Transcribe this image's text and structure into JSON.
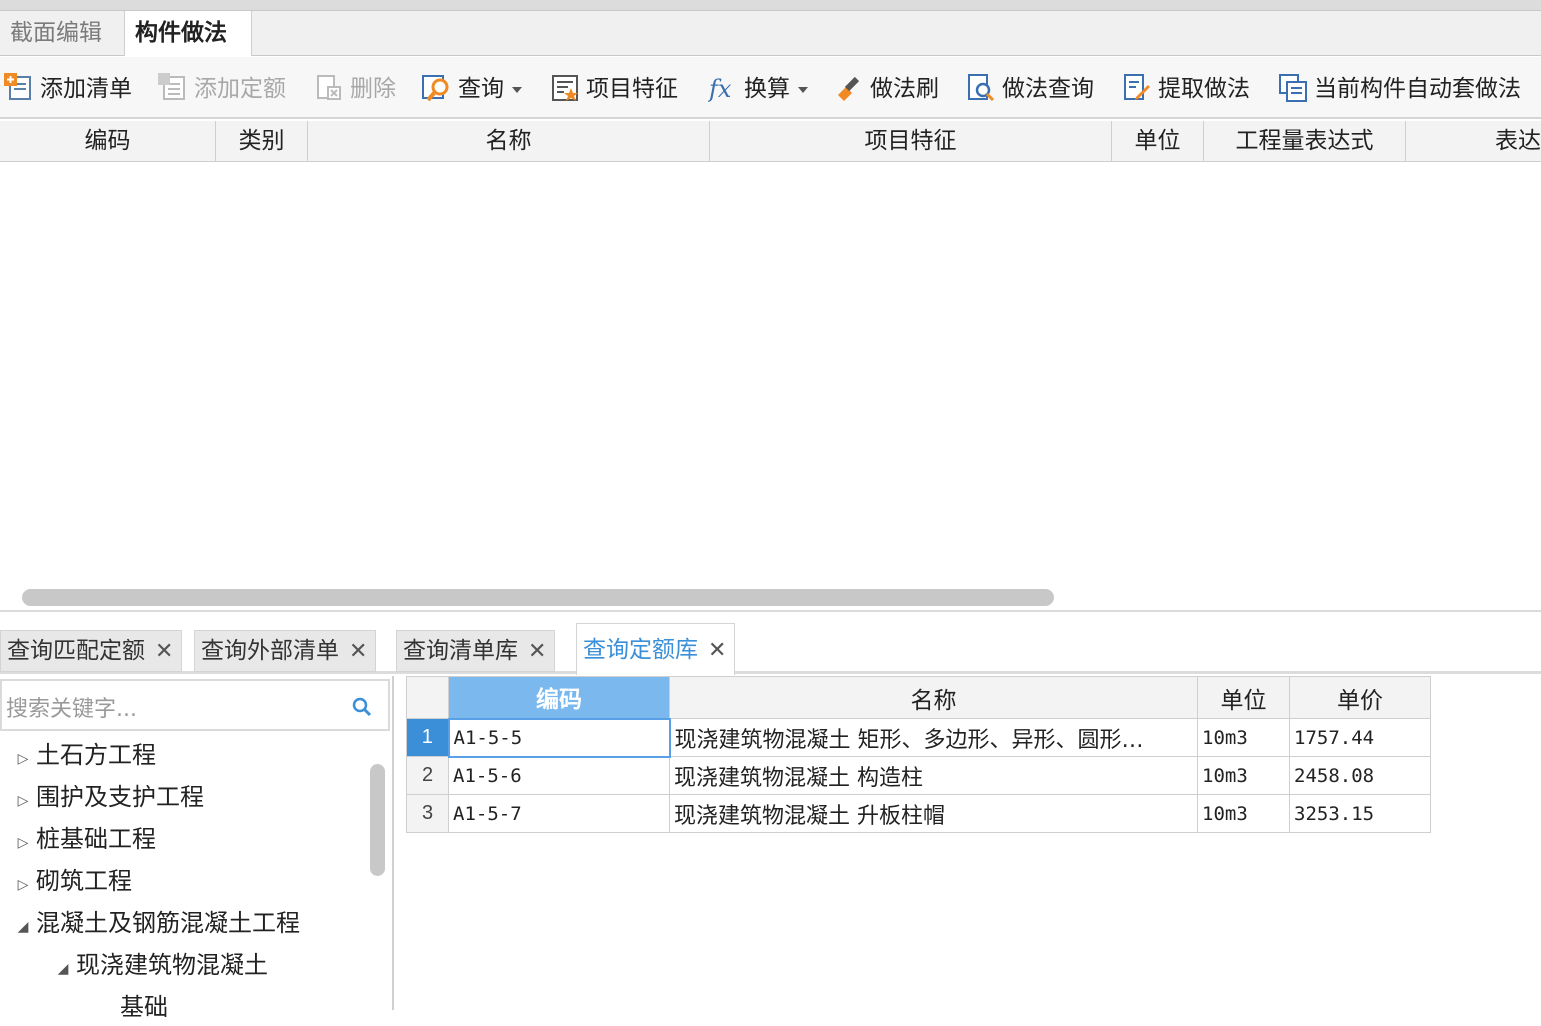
{
  "tabs": [
    {
      "label": "截面编辑",
      "active": false
    },
    {
      "label": "构件做法",
      "active": true
    }
  ],
  "toolbar": {
    "add_list": "添加清单",
    "add_quota": "添加定额",
    "delete": "删除",
    "query": "查询",
    "item_feature": "项目特征",
    "convert": "换算",
    "method_brush": "做法刷",
    "method_query": "做法查询",
    "extract_method": "提取做法",
    "auto_apply": "当前构件自动套做法"
  },
  "main_grid": {
    "columns": [
      "编码",
      "类别",
      "名称",
      "项目特征",
      "单位",
      "工程量表达式",
      "表达"
    ]
  },
  "query_tabs": [
    {
      "label": "查询匹配定额",
      "active": false
    },
    {
      "label": "查询外部清单",
      "active": false
    },
    {
      "label": "查询清单库",
      "active": false
    },
    {
      "label": "查询定额库",
      "active": true
    }
  ],
  "search": {
    "placeholder": "搜索关键字..."
  },
  "tree": [
    {
      "label": "土石方工程",
      "level": 0,
      "expanded": false
    },
    {
      "label": "围护及支护工程",
      "level": 0,
      "expanded": false
    },
    {
      "label": "桩基础工程",
      "level": 0,
      "expanded": false
    },
    {
      "label": "砌筑工程",
      "level": 0,
      "expanded": false
    },
    {
      "label": "混凝土及钢筋混凝土工程",
      "level": 0,
      "expanded": true
    },
    {
      "label": "现浇建筑物混凝土",
      "level": 1,
      "expanded": true
    },
    {
      "label": "基础",
      "level": 2,
      "expanded": null
    }
  ],
  "results": {
    "columns": [
      "编码",
      "名称",
      "单位",
      "单价"
    ],
    "rows": [
      {
        "n": "1",
        "code": "A1-5-5",
        "name": "现浇建筑物混凝土  矩形、多边形、异形、圆形…",
        "unit": "10m3",
        "price": "1757.44"
      },
      {
        "n": "2",
        "code": "A1-5-6",
        "name": "现浇建筑物混凝土  构造柱",
        "unit": "10m3",
        "price": "2458.08"
      },
      {
        "n": "3",
        "code": "A1-5-7",
        "name": "现浇建筑物混凝土  升板柱帽",
        "unit": "10m3",
        "price": "3253.15"
      }
    ]
  },
  "colors": {
    "accent": "#3a8fd8",
    "header_selected": "#7ab8ee"
  }
}
